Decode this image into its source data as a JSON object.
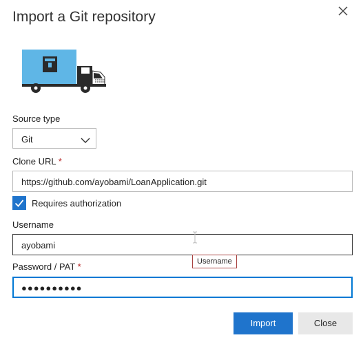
{
  "dialog": {
    "title": "Import a Git repository"
  },
  "source_type": {
    "label": "Source type",
    "value": "Git"
  },
  "clone_url": {
    "label": "Clone URL",
    "required_mark": "*",
    "value": "https://github.com/ayobami/LoanApplication.git"
  },
  "auth": {
    "checked": true,
    "label": "Requires authorization"
  },
  "username": {
    "label": "Username",
    "value": "ayobami",
    "tooltip": "Username"
  },
  "password": {
    "label": "Password / PAT",
    "required_mark": "*",
    "value": "●●●●●●●●●●"
  },
  "buttons": {
    "import": "Import",
    "close": "Close"
  },
  "colors": {
    "accent": "#1f74cc",
    "truck_box": "#5fb6e6",
    "required": "#b52222"
  },
  "icons": {
    "close": "close-icon",
    "dropdown": "chevron-down-icon",
    "checkbox": "checkmark-icon",
    "illustration": "truck-illustration"
  }
}
